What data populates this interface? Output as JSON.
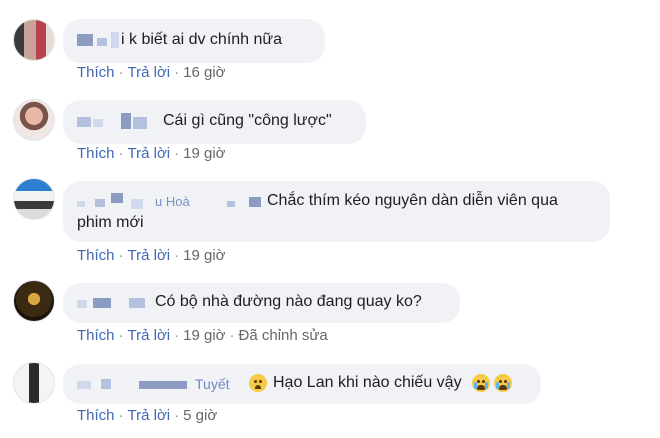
{
  "comments": [
    {
      "text": "i k biết ai dv chính nữa",
      "actions": {
        "like": "Thích",
        "reply": "Trả lời",
        "time": "16 giờ"
      }
    },
    {
      "text": "Cái gì cũng \"công lược\"",
      "actions": {
        "like": "Thích",
        "reply": "Trả lời",
        "time": "19 giờ"
      }
    },
    {
      "name_fragment": "u Hoà",
      "text_line1": "Chắc thím kéo nguyên dàn diễn viên qua",
      "text_line2": "phim mới",
      "actions": {
        "like": "Thích",
        "reply": "Trả lời",
        "time": "19 giờ"
      }
    },
    {
      "text": "Có bộ nhà đường nào đang quay ko?",
      "actions": {
        "like": "Thích",
        "reply": "Trả lời",
        "time": "19 giờ",
        "edited": "Đã chỉnh sửa"
      }
    },
    {
      "name_fragment": "Tuyết",
      "text": "Hạo Lan khi nào chiếu vậy",
      "emojis": [
        "frowning-face",
        "crying-face",
        "crying-face"
      ],
      "actions": {
        "like": "Thích",
        "reply": "Trả lời",
        "time": "5 giờ"
      }
    }
  ],
  "separator": "·",
  "colors": {
    "bubble": "#f0f2f5",
    "action_link": "#4267b2",
    "meta": "#65676b",
    "text": "#1c1e21"
  }
}
